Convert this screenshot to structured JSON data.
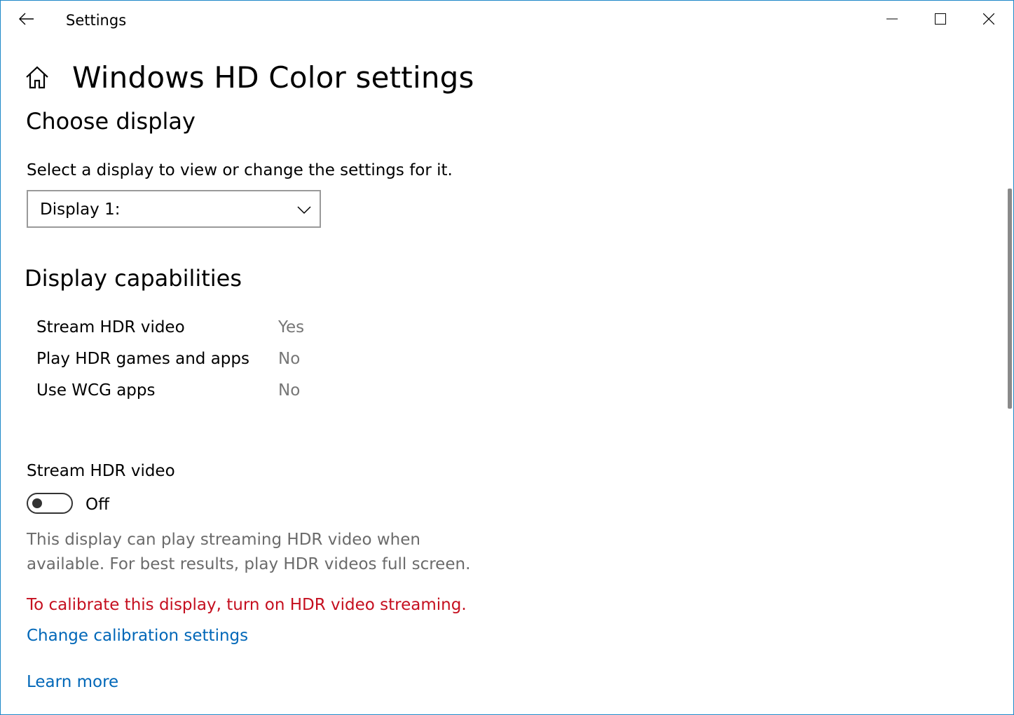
{
  "window": {
    "title": "Settings",
    "accent_color": "#1e88c8"
  },
  "titlebar": {
    "back_icon": "back-arrow-icon",
    "minimize_icon": "minimize-icon",
    "maximize_icon": "maximize-icon",
    "close_icon": "close-icon"
  },
  "page": {
    "title": "Windows HD Color settings",
    "home_icon": "home-icon"
  },
  "choose_display": {
    "heading": "Choose display",
    "description": "Select a display to view or change the settings for it.",
    "dropdown_value": "Display 1:"
  },
  "capabilities": {
    "heading": "Display capabilities",
    "rows": [
      {
        "label": "Stream HDR video",
        "value": "Yes"
      },
      {
        "label": "Play HDR games and apps",
        "value": "No"
      },
      {
        "label": "Use WCG apps",
        "value": "No"
      }
    ]
  },
  "stream_hdr": {
    "label": "Stream HDR video",
    "toggle_state": "Off",
    "description": "This display can play streaming HDR video when available. For best results, play HDR videos full screen.",
    "warning": "To calibrate this display, turn on HDR video streaming.",
    "warning_color": "#c50f1f"
  },
  "links": {
    "calibration": "Change calibration settings",
    "learn_more": "Learn more",
    "link_color": "#0067b8"
  }
}
